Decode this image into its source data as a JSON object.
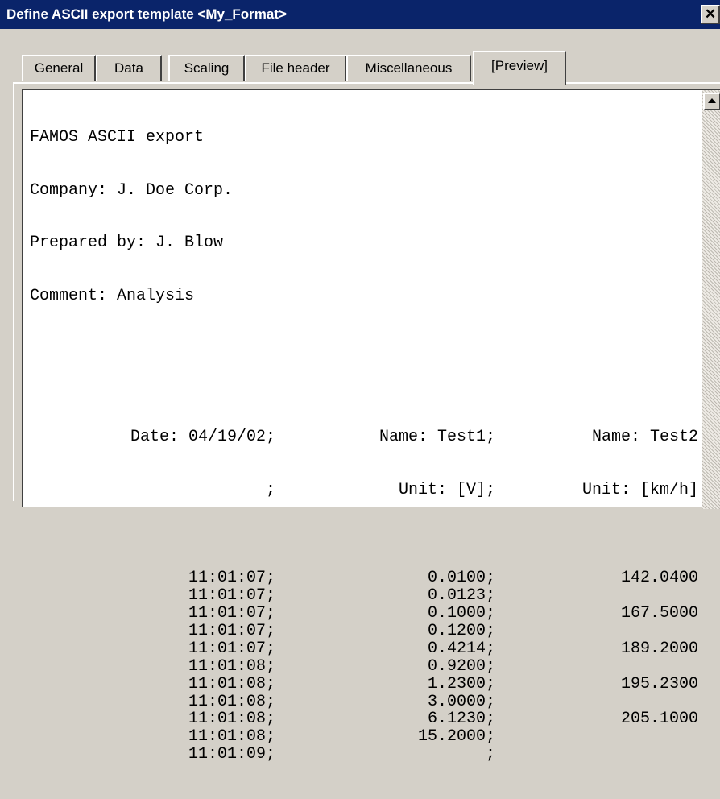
{
  "window": {
    "title": "Define ASCII export template <My_Format>",
    "close_glyph": "✕"
  },
  "tabs": [
    {
      "label": "General"
    },
    {
      "label": "Data"
    },
    {
      "label": "Scaling"
    },
    {
      "label": "File header"
    },
    {
      "label": "Miscellaneous"
    },
    {
      "label": "[Preview]",
      "active": true
    }
  ],
  "preview": {
    "header_lines": [
      "FAMOS ASCII export",
      "Company: J. Doe Corp.",
      "Prepared by: J. Blow",
      "Comment: Analysis"
    ],
    "columns": [
      {
        "line1": "Date: 04/19/02;",
        "line2": ";"
      },
      {
        "line1": "Name: Test1;",
        "line2": "Unit: [V];"
      },
      {
        "line1": "Name: Test2",
        "line2": "Unit: [km/h]"
      }
    ],
    "rows": [
      {
        "time": "11:01:07;",
        "v1": "0.0100;",
        "v2": "142.0400"
      },
      {
        "time": "11:01:07;",
        "v1": "0.0123;",
        "v2": ""
      },
      {
        "time": "11:01:07;",
        "v1": "0.1000;",
        "v2": "167.5000"
      },
      {
        "time": "11:01:07;",
        "v1": "0.1200;",
        "v2": ""
      },
      {
        "time": "11:01:07;",
        "v1": "0.4214;",
        "v2": "189.2000"
      },
      {
        "time": "11:01:08;",
        "v1": "0.9200;",
        "v2": ""
      },
      {
        "time": "11:01:08;",
        "v1": "1.2300;",
        "v2": "195.2300"
      },
      {
        "time": "11:01:08;",
        "v1": "3.0000;",
        "v2": ""
      },
      {
        "time": "11:01:08;",
        "v1": "6.1230;",
        "v2": "205.1000"
      },
      {
        "time": "11:01:08;",
        "v1": "15.2000;",
        "v2": ""
      },
      {
        "time": "11:01:09;",
        "v1": ";",
        "v2": ""
      }
    ]
  }
}
